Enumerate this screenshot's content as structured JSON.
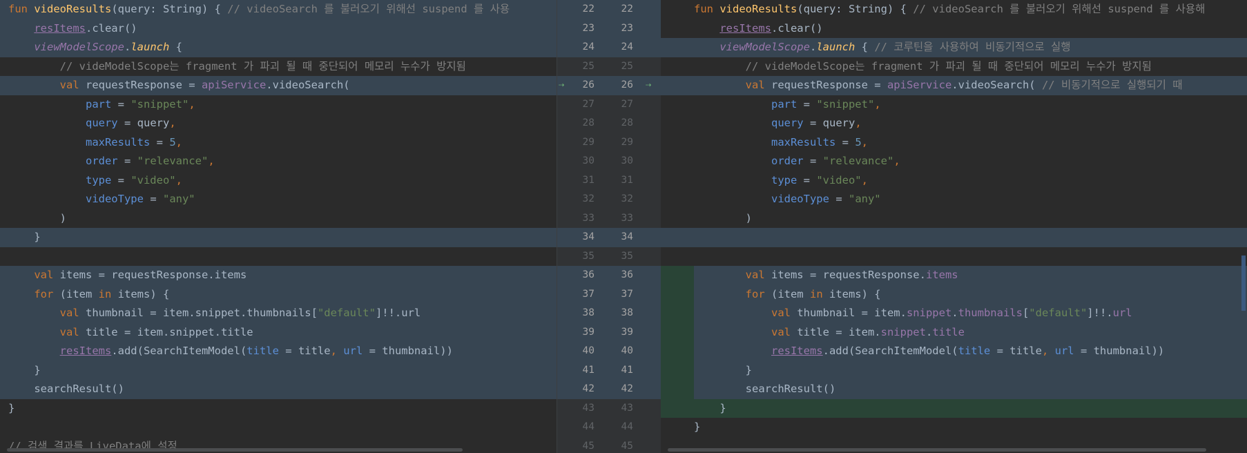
{
  "left": [
    {
      "type": "mod",
      "tokens": [
        {
          "t": "fun ",
          "c": "kw"
        },
        {
          "t": "videoResults",
          "c": "fn"
        },
        {
          "t": "(query: String) { "
        },
        {
          "t": "// videoSearch 를 불러오기 위해선 suspend 를 사용",
          "c": "cmt"
        }
      ]
    },
    {
      "type": "mod",
      "tokens": [
        {
          "t": "    "
        },
        {
          "t": "resItems",
          "c": "under"
        },
        {
          "t": ".clear()"
        }
      ]
    },
    {
      "type": "mod",
      "tokens": [
        {
          "t": "    "
        },
        {
          "t": "viewModelScope",
          "c": "ital"
        },
        {
          "t": "."
        },
        {
          "t": "launch",
          "c": "launch"
        },
        {
          "t": " {"
        }
      ]
    },
    {
      "type": "",
      "tokens": [
        {
          "t": "        "
        },
        {
          "t": "// videModelScope는 fragment 가 파괴 될 때 중단되어 메모리 누수가 방지됨",
          "c": "cmt"
        }
      ]
    },
    {
      "type": "mod",
      "tokens": [
        {
          "t": "        "
        },
        {
          "t": "val ",
          "c": "kw"
        },
        {
          "t": "requestResponse = "
        },
        {
          "t": "apiService",
          "c": "prop"
        },
        {
          "t": ".videoSearch("
        }
      ]
    },
    {
      "type": "",
      "tokens": [
        {
          "t": "            "
        },
        {
          "t": "part",
          "c": "param"
        },
        {
          "t": " = "
        },
        {
          "t": "\"snippet\"",
          "c": "str"
        },
        {
          "t": ",",
          "c": "kw"
        }
      ]
    },
    {
      "type": "",
      "tokens": [
        {
          "t": "            "
        },
        {
          "t": "query",
          "c": "param"
        },
        {
          "t": " = query"
        },
        {
          "t": ",",
          "c": "kw"
        }
      ]
    },
    {
      "type": "",
      "tokens": [
        {
          "t": "            "
        },
        {
          "t": "maxResults",
          "c": "param"
        },
        {
          "t": " = "
        },
        {
          "t": "5",
          "c": "num"
        },
        {
          "t": ",",
          "c": "kw"
        }
      ]
    },
    {
      "type": "",
      "tokens": [
        {
          "t": "            "
        },
        {
          "t": "order",
          "c": "param"
        },
        {
          "t": " = "
        },
        {
          "t": "\"relevance\"",
          "c": "str"
        },
        {
          "t": ",",
          "c": "kw"
        }
      ]
    },
    {
      "type": "",
      "tokens": [
        {
          "t": "            "
        },
        {
          "t": "type",
          "c": "param"
        },
        {
          "t": " = "
        },
        {
          "t": "\"video\"",
          "c": "str"
        },
        {
          "t": ",",
          "c": "kw"
        }
      ]
    },
    {
      "type": "",
      "tokens": [
        {
          "t": "            "
        },
        {
          "t": "videoType",
          "c": "param"
        },
        {
          "t": " = "
        },
        {
          "t": "\"any\"",
          "c": "str"
        }
      ]
    },
    {
      "type": "",
      "tokens": [
        {
          "t": "        )"
        }
      ]
    },
    {
      "type": "mod",
      "tokens": [
        {
          "t": "    }"
        }
      ]
    },
    {
      "type": "",
      "tokens": [
        {
          "t": ""
        }
      ]
    },
    {
      "type": "mod",
      "tokens": [
        {
          "t": "    "
        },
        {
          "t": "val ",
          "c": "kw"
        },
        {
          "t": "items = requestResponse.items"
        }
      ]
    },
    {
      "type": "mod",
      "tokens": [
        {
          "t": "    "
        },
        {
          "t": "for ",
          "c": "kw"
        },
        {
          "t": "(item "
        },
        {
          "t": "in ",
          "c": "kw"
        },
        {
          "t": "items) {"
        }
      ]
    },
    {
      "type": "mod",
      "tokens": [
        {
          "t": "        "
        },
        {
          "t": "val ",
          "c": "kw"
        },
        {
          "t": "thumbnail = item.snippet.thumbnails["
        },
        {
          "t": "\"default\"",
          "c": "str"
        },
        {
          "t": "]!!.url"
        }
      ]
    },
    {
      "type": "mod",
      "tokens": [
        {
          "t": "        "
        },
        {
          "t": "val ",
          "c": "kw"
        },
        {
          "t": "title = item.snippet.title"
        }
      ]
    },
    {
      "type": "mod",
      "tokens": [
        {
          "t": "        "
        },
        {
          "t": "resItems",
          "c": "under"
        },
        {
          "t": ".add(SearchItemModel("
        },
        {
          "t": "title",
          "c": "param"
        },
        {
          "t": " = title"
        },
        {
          "t": ", ",
          "c": "kw"
        },
        {
          "t": "url",
          "c": "param"
        },
        {
          "t": " = thumbnail))"
        }
      ]
    },
    {
      "type": "mod",
      "tokens": [
        {
          "t": "    }"
        }
      ]
    },
    {
      "type": "mod",
      "tokens": [
        {
          "t": "    searchResult()"
        }
      ]
    },
    {
      "type": "",
      "tokens": [
        {
          "t": "}"
        }
      ]
    },
    {
      "type": "",
      "tokens": [
        {
          "t": ""
        }
      ]
    },
    {
      "type": "",
      "tokens": [
        {
          "t": "// 검색 결과를 LiveData에 설정",
          "c": "cmt"
        }
      ]
    }
  ],
  "gutter": {
    "left_numbers": [
      "22",
      "23",
      "24",
      "25",
      "26",
      "27",
      "28",
      "29",
      "30",
      "31",
      "32",
      "33",
      "34",
      "35",
      "36",
      "37",
      "38",
      "39",
      "40",
      "41",
      "42",
      "43",
      "44",
      "45"
    ],
    "right_numbers": [
      "22",
      "23",
      "24",
      "25",
      "26",
      "27",
      "28",
      "29",
      "30",
      "31",
      "32",
      "33",
      "34",
      "35",
      "36",
      "37",
      "38",
      "39",
      "40",
      "41",
      "42",
      "43",
      "44",
      "45"
    ],
    "arrow_glyph": "⇢"
  },
  "right": [
    {
      "type": "",
      "tokens": [
        {
          "t": "fun ",
          "c": "kw"
        },
        {
          "t": "videoResults",
          "c": "fn"
        },
        {
          "t": "(query: String) { "
        },
        {
          "t": "// videoSearch 를 불러오기 위해선 suspend 를 사용해",
          "c": "cmt"
        }
      ]
    },
    {
      "type": "",
      "tokens": [
        {
          "t": "    "
        },
        {
          "t": "resItems",
          "c": "under"
        },
        {
          "t": ".clear()"
        }
      ]
    },
    {
      "type": "mod",
      "tokens": [
        {
          "t": "    "
        },
        {
          "t": "viewModelScope",
          "c": "ital"
        },
        {
          "t": "."
        },
        {
          "t": "launch",
          "c": "launch"
        },
        {
          "t": " { "
        },
        {
          "t": "// 코루틴을 사용하여 비동기적으로 실행",
          "c": "cmt"
        }
      ]
    },
    {
      "type": "",
      "tokens": [
        {
          "t": "        "
        },
        {
          "t": "// videModelScope는 fragment 가 파괴 될 때 중단되어 메모리 누수가 방지됨",
          "c": "cmt"
        }
      ]
    },
    {
      "type": "mod",
      "tokens": [
        {
          "t": "        "
        },
        {
          "t": "val ",
          "c": "kw"
        },
        {
          "t": "requestResponse = "
        },
        {
          "t": "apiService",
          "c": "prop"
        },
        {
          "t": ".videoSearch( "
        },
        {
          "t": "// 비동기적으로 실행되기 때",
          "c": "cmt"
        }
      ]
    },
    {
      "type": "",
      "tokens": [
        {
          "t": "            "
        },
        {
          "t": "part",
          "c": "param"
        },
        {
          "t": " = "
        },
        {
          "t": "\"snippet\"",
          "c": "str"
        },
        {
          "t": ",",
          "c": "kw"
        }
      ]
    },
    {
      "type": "",
      "tokens": [
        {
          "t": "            "
        },
        {
          "t": "query",
          "c": "param"
        },
        {
          "t": " = query"
        },
        {
          "t": ",",
          "c": "kw"
        }
      ]
    },
    {
      "type": "",
      "tokens": [
        {
          "t": "            "
        },
        {
          "t": "maxResults",
          "c": "param"
        },
        {
          "t": " = "
        },
        {
          "t": "5",
          "c": "num"
        },
        {
          "t": ",",
          "c": "kw"
        }
      ]
    },
    {
      "type": "",
      "tokens": [
        {
          "t": "            "
        },
        {
          "t": "order",
          "c": "param"
        },
        {
          "t": " = "
        },
        {
          "t": "\"relevance\"",
          "c": "str"
        },
        {
          "t": ",",
          "c": "kw"
        }
      ]
    },
    {
      "type": "",
      "tokens": [
        {
          "t": "            "
        },
        {
          "t": "type",
          "c": "param"
        },
        {
          "t": " = "
        },
        {
          "t": "\"video\"",
          "c": "str"
        },
        {
          "t": ",",
          "c": "kw"
        }
      ]
    },
    {
      "type": "",
      "tokens": [
        {
          "t": "            "
        },
        {
          "t": "videoType",
          "c": "param"
        },
        {
          "t": " = "
        },
        {
          "t": "\"any\"",
          "c": "str"
        }
      ]
    },
    {
      "type": "",
      "tokens": [
        {
          "t": "        )"
        }
      ]
    },
    {
      "type": "mod",
      "tokens": [
        {
          "t": ""
        }
      ]
    },
    {
      "type": "",
      "tokens": [
        {
          "t": ""
        }
      ]
    },
    {
      "type": "mod",
      "tokens": [
        {
          "t": "        "
        },
        {
          "t": "val ",
          "c": "kw"
        },
        {
          "t": "items = requestResponse."
        },
        {
          "t": "items",
          "c": "prop"
        }
      ]
    },
    {
      "type": "mod",
      "tokens": [
        {
          "t": "        "
        },
        {
          "t": "for ",
          "c": "kw"
        },
        {
          "t": "(item "
        },
        {
          "t": "in ",
          "c": "kw"
        },
        {
          "t": "items) {"
        }
      ]
    },
    {
      "type": "mod",
      "tokens": [
        {
          "t": "            "
        },
        {
          "t": "val ",
          "c": "kw"
        },
        {
          "t": "thumbnail = item."
        },
        {
          "t": "snippet",
          "c": "prop"
        },
        {
          "t": "."
        },
        {
          "t": "thumbnails",
          "c": "prop"
        },
        {
          "t": "["
        },
        {
          "t": "\"default\"",
          "c": "str"
        },
        {
          "t": "]!!."
        },
        {
          "t": "url",
          "c": "prop"
        }
      ]
    },
    {
      "type": "mod",
      "tokens": [
        {
          "t": "            "
        },
        {
          "t": "val ",
          "c": "kw"
        },
        {
          "t": "title = item."
        },
        {
          "t": "snippet",
          "c": "prop"
        },
        {
          "t": "."
        },
        {
          "t": "title",
          "c": "prop"
        }
      ]
    },
    {
      "type": "mod",
      "tokens": [
        {
          "t": "            "
        },
        {
          "t": "resItems",
          "c": "under"
        },
        {
          "t": ".add(SearchItemModel("
        },
        {
          "t": "title",
          "c": "param"
        },
        {
          "t": " = title"
        },
        {
          "t": ", ",
          "c": "kw"
        },
        {
          "t": "url",
          "c": "param"
        },
        {
          "t": " = thumbnail))"
        }
      ]
    },
    {
      "type": "mod",
      "tokens": [
        {
          "t": "        }"
        }
      ]
    },
    {
      "type": "mod",
      "tokens": [
        {
          "t": "        searchResult()"
        }
      ]
    },
    {
      "type": "add",
      "tokens": [
        {
          "t": "    }"
        }
      ]
    },
    {
      "type": "",
      "tokens": [
        {
          "t": "}"
        }
      ]
    },
    {
      "type": "",
      "tokens": [
        {
          "t": ""
        }
      ]
    }
  ],
  "colors": {
    "modified": "#374552",
    "added": "#294436",
    "background": "#2b2b2b"
  }
}
